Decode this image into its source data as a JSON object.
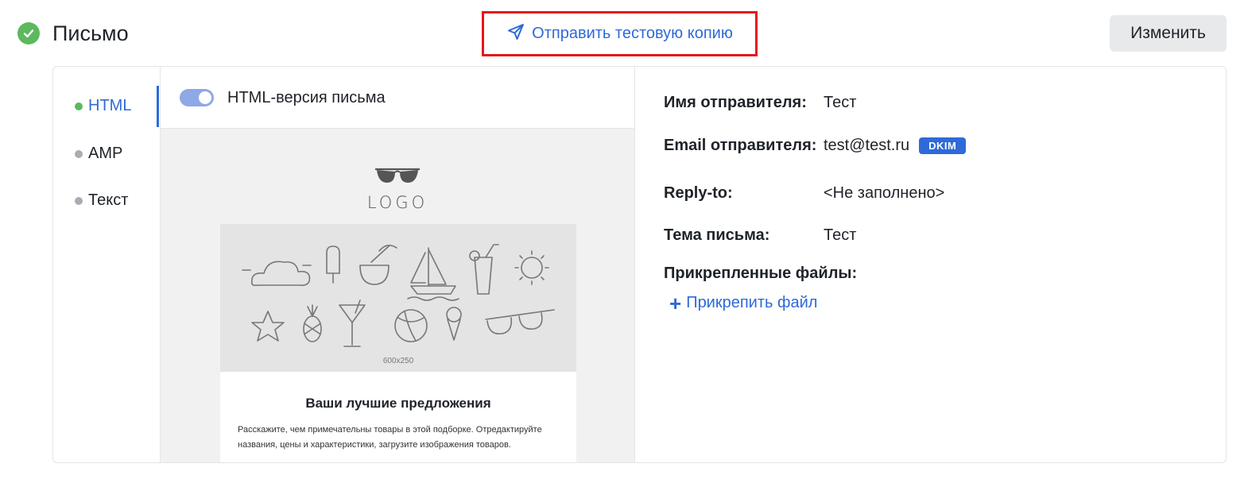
{
  "header": {
    "title": "Письмо",
    "send_test_label": "Отправить тестовую копию",
    "edit_label": "Изменить"
  },
  "tabs": [
    {
      "label": "HTML",
      "active": true
    },
    {
      "label": "AMP",
      "active": false
    },
    {
      "label": "Текст",
      "active": false
    }
  ],
  "preview": {
    "toggle_label": "HTML-версия письма",
    "toggle_on": true,
    "logo_text": "LOGO",
    "hero_size": "600x250",
    "heading": "Ваши лучшие предложения",
    "paragraph": "Расскажите, чем примечательны товары в этой подборке. Отредактируйте названия, цены и характеристики, загрузите изображения товаров."
  },
  "details": {
    "sender_name_label": "Имя отправителя:",
    "sender_name": "Тест",
    "sender_email_label": "Email отправителя:",
    "sender_email": "test@test.ru",
    "dkim_badge": "DKIM",
    "reply_to_label": "Reply-to:",
    "reply_to": "<Не заполнено>",
    "subject_label": "Тема письма:",
    "subject": "Тест",
    "attachments_label": "Прикрепленные файлы:",
    "attach_label": "Прикрепить файл"
  },
  "colors": {
    "accent": "#2e6ad8",
    "success": "#5cb95e",
    "highlight_border": "#e5161c"
  },
  "icons": {
    "status": "check-circle-icon",
    "send": "paper-plane-icon",
    "attach": "plus-icon"
  }
}
